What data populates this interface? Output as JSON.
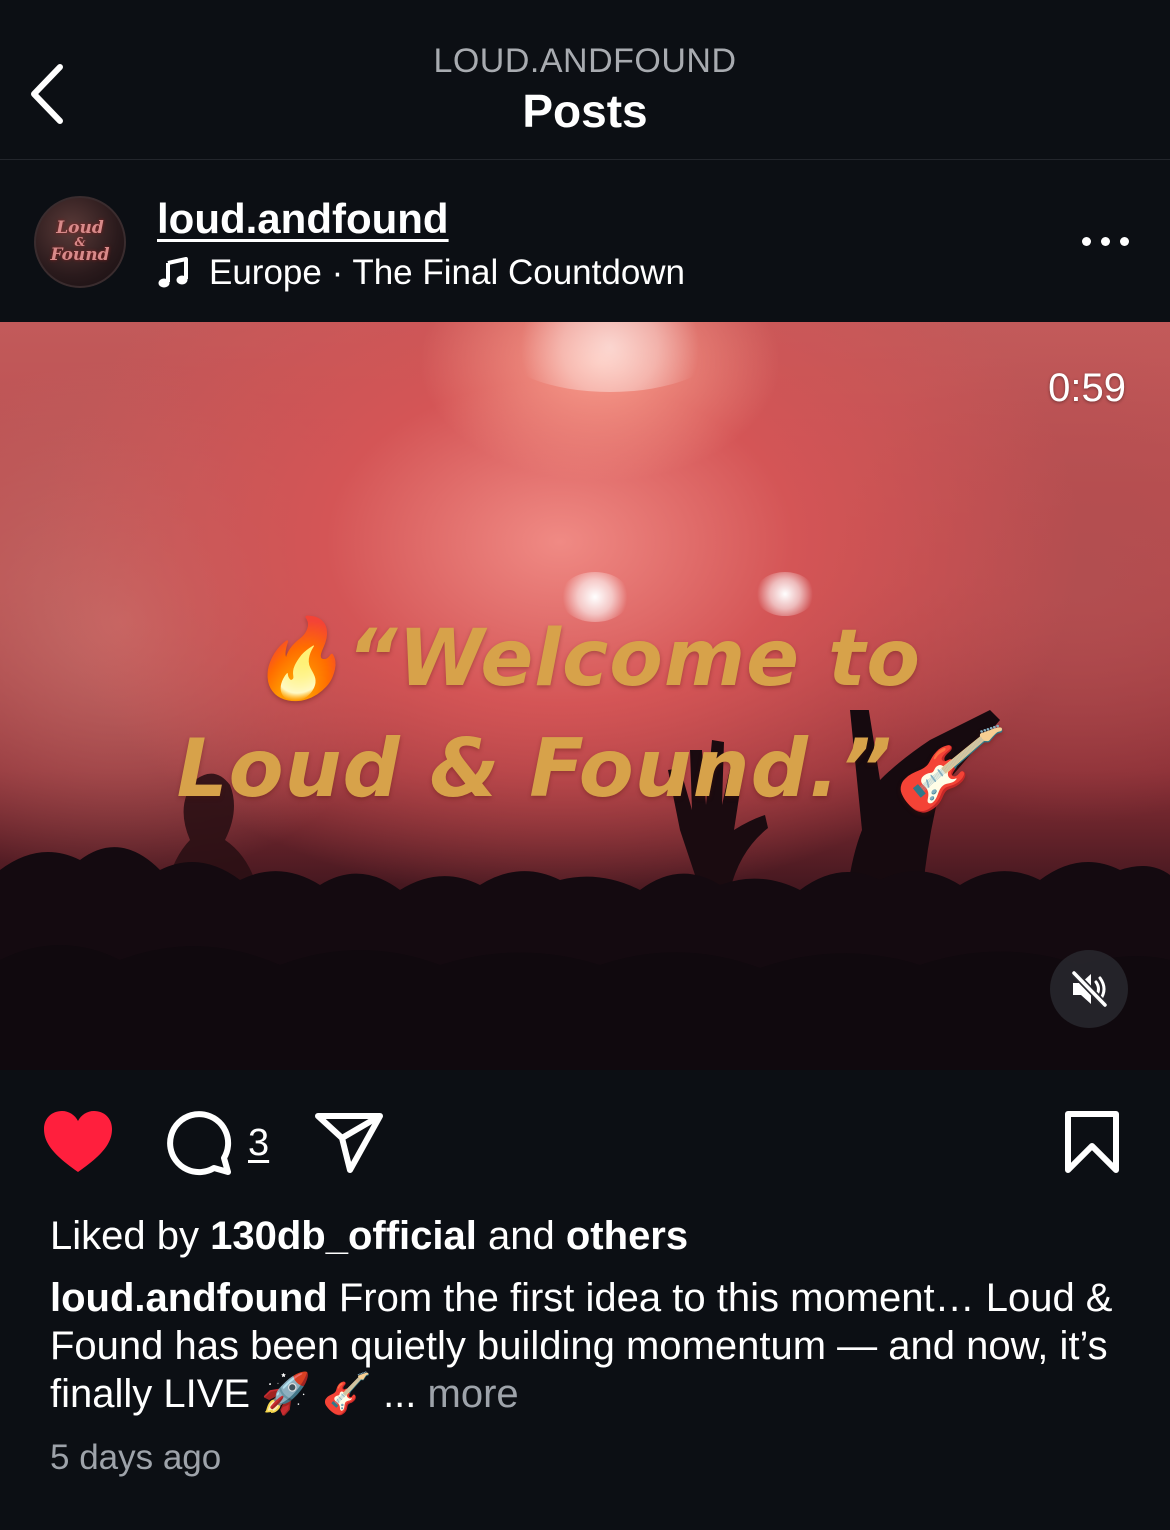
{
  "header": {
    "subtitle": "LOUD.ANDFOUND",
    "title": "Posts",
    "back_icon": "chevron-left-icon"
  },
  "post": {
    "username": "loud.andfound",
    "music": {
      "icon": "music-note-icon",
      "text": "Europe · The Final Countdown"
    },
    "avatar_text_top": "Loud",
    "avatar_text_mid": "&",
    "avatar_text_bottom": "Found",
    "more_icon": "more-horizontal-icon",
    "video": {
      "duration": "0:59",
      "overlay_line1": "🔥“Welcome to",
      "overlay_line2": "Loud & Found.”🎸",
      "mute_icon": "speaker-muted-icon",
      "overlay_color": "#d7a24a"
    },
    "actions": {
      "like_icon": "heart-filled-icon",
      "like_color": "#ff1f3d",
      "comment_icon": "comment-icon",
      "comment_count": "3",
      "share_icon": "send-icon",
      "save_icon": "bookmark-icon"
    },
    "likes": {
      "prefix": "Liked by",
      "user": "130db_official",
      "conj": "and",
      "others": "others"
    },
    "caption": {
      "user": "loud.andfound",
      "text": "From the first idea to this moment… Loud & Found has been quietly building momentum — and now, it’s finally LIVE 🚀 🎸",
      "ellipsis": "...",
      "more": "more"
    },
    "timestamp": "5 days ago"
  }
}
